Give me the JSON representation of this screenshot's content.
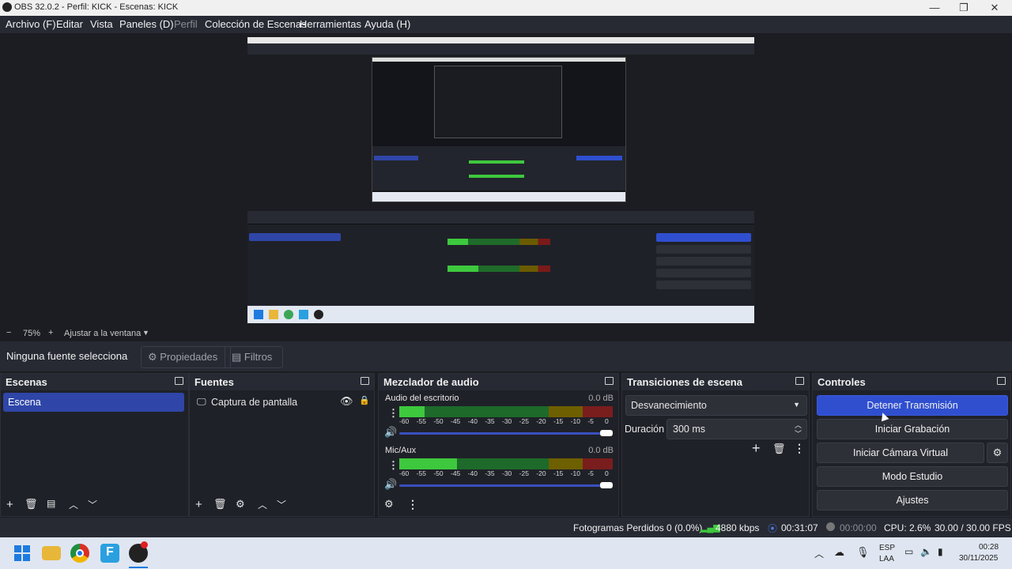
{
  "window": {
    "title": "OBS 32.0.2 - Perfil: KICK - Escenas: KICK",
    "minimize": "—",
    "maximize": "❐",
    "close": "✕"
  },
  "menu": {
    "items": [
      "Archivo (F)",
      "Editar",
      "Vista",
      "Paneles (D)",
      "Perfil",
      "Colección de Escenas",
      "Herramientas",
      "Ayuda (H)"
    ]
  },
  "zoom": {
    "minus": "−",
    "value": "75%",
    "plus": "+",
    "fit_label": "Ajustar a la ventana"
  },
  "source_toolbar": {
    "no_source": "Ninguna fuente selecciona",
    "properties": "Propiedades",
    "filters": "Filtros"
  },
  "scenes": {
    "title": "Escenas",
    "items": [
      "Escena"
    ],
    "selected": "Escena"
  },
  "sources": {
    "title": "Fuentes",
    "items": [
      "Captura de pantalla"
    ]
  },
  "mixer": {
    "title": "Mezclador de audio",
    "channels": [
      {
        "name": "Audio del escritorio",
        "db": "0.0 dB",
        "level": 0.12,
        "volume": 1.0
      },
      {
        "name": "Mic/Aux",
        "db": "0.0 dB",
        "level": 0.27,
        "volume": 1.0
      }
    ],
    "ticks": [
      "-60",
      "-55",
      "-50",
      "-45",
      "-40",
      "-35",
      "-30",
      "-25",
      "-20",
      "-15",
      "-10",
      "-5",
      "0"
    ]
  },
  "transitions": {
    "title": "Transiciones de escena",
    "selected": "Desvanecimiento",
    "duration_label": "Duración",
    "duration_value": "300 ms"
  },
  "controls": {
    "title": "Controles",
    "stop_stream": "Detener Transmisión",
    "start_record": "Iniciar Grabación",
    "virtual_cam": "Iniciar Cámara Virtual",
    "studio_mode": "Modo Estudio",
    "settings": "Ajustes"
  },
  "status": {
    "dropped": "Fotogramas Perdidos 0 (0.0%)",
    "bitrate": "4880 kbps",
    "stream_time": "00:31:07",
    "record_time": "00:00:00",
    "cpu": "CPU: 2.6%",
    "fps": "30.00 / 30.00 FPS"
  },
  "colors": {
    "accent": "#2f4fcf",
    "meter_green": "#3ec83e",
    "meter_yellow": "#c8b400",
    "meter_red": "#c83232"
  },
  "taskbar": {
    "lang1": "ESP",
    "lang2": "LAA",
    "time": "00:28",
    "date": "30/11/2025"
  }
}
